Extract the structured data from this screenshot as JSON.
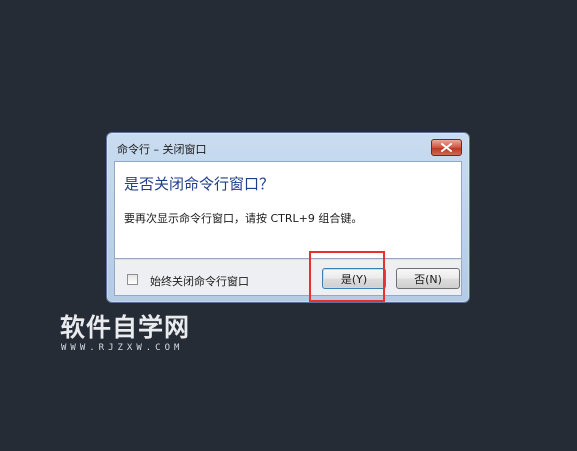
{
  "dialog": {
    "title": "命令行 – 关闭窗口",
    "main_instruction": "是否关闭命令行窗口？",
    "description": "要再次显示命令行窗口，请按 CTRL+9 组合键。",
    "checkbox": {
      "label": "始终关闭命令行窗口",
      "checked": false
    },
    "buttons": {
      "yes_label": "是(Y)",
      "no_label": "否(N)"
    },
    "close_icon": "close-x-icon"
  },
  "annotation": {
    "highlight_color": "#e8312f"
  },
  "watermark": {
    "text": "软件自学网",
    "url": "WWW.RJZXW.COM"
  },
  "colors": {
    "background": "#262c36",
    "instruction_blue": "#1e3f8c",
    "close_red": "#c44a33"
  }
}
